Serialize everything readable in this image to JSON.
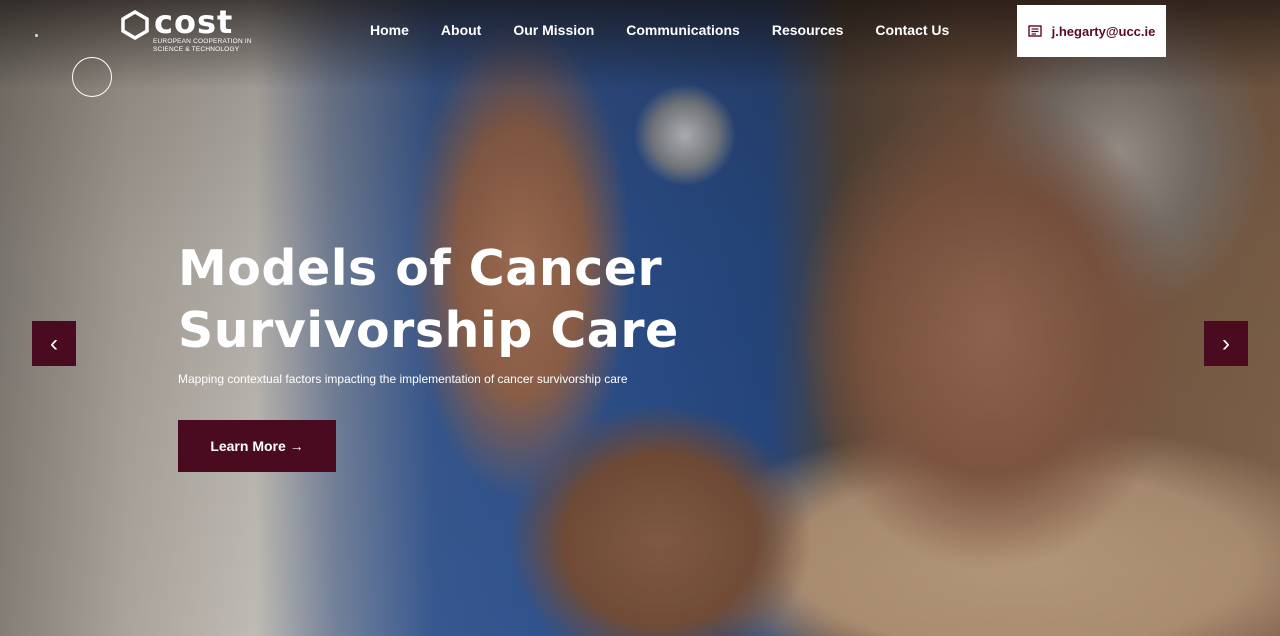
{
  "brand": {
    "logo_text": "cost",
    "logo_sub": "EUROPEAN COOPERATION IN SCIENCE & TECHNOLOGY"
  },
  "nav": {
    "items": [
      "Home",
      "About",
      "Our Mission",
      "Communications",
      "Resources",
      "Contact Us"
    ]
  },
  "contact": {
    "email": "j.hegarty@ucc.ie",
    "icon": "email-icon"
  },
  "hero": {
    "title_line1": "Models of Cancer",
    "title_line2": "Survivorship Care",
    "subtitle": "Mapping contextual factors impacting the implementation of cancer survivorship care",
    "cta_label": "Learn More →",
    "prev_label": "‹",
    "next_label": "›"
  },
  "colors": {
    "accent": "#4a0a20",
    "email_text": "#5a0a22"
  }
}
